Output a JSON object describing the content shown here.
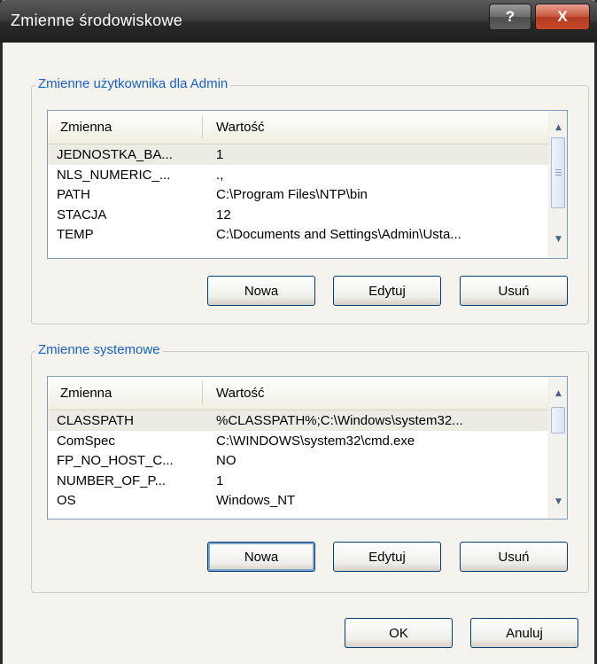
{
  "window": {
    "title": "Zmienne środowiskowe",
    "help_label": "?",
    "close_label": "X"
  },
  "user_group": {
    "title": "Zmienne użytkownika dla Admin",
    "columns": [
      "Zmienna",
      "Wartość"
    ],
    "rows": [
      {
        "name": "JEDNOSTKA_BA...",
        "value": "1"
      },
      {
        "name": "NLS_NUMERIC_...",
        "value": ".,"
      },
      {
        "name": "PATH",
        "value": "C:\\Program Files\\NTP\\bin"
      },
      {
        "name": "STACJA",
        "value": "12"
      },
      {
        "name": "TEMP",
        "value": "C:\\Documents and Settings\\Admin\\Usta..."
      }
    ],
    "buttons": {
      "new": "Nowa",
      "edit": "Edytuj",
      "delete": "Usuń"
    }
  },
  "system_group": {
    "title": "Zmienne systemowe",
    "columns": [
      "Zmienna",
      "Wartość"
    ],
    "rows": [
      {
        "name": "CLASSPATH",
        "value": "%CLASSPATH%;C:\\Windows\\system32..."
      },
      {
        "name": "ComSpec",
        "value": "C:\\WINDOWS\\system32\\cmd.exe"
      },
      {
        "name": "FP_NO_HOST_C...",
        "value": "NO"
      },
      {
        "name": "NUMBER_OF_P...",
        "value": "1"
      },
      {
        "name": "OS",
        "value": "Windows_NT"
      }
    ],
    "buttons": {
      "new": "Nowa",
      "edit": "Edytuj",
      "delete": "Usuń"
    }
  },
  "footer": {
    "ok": "OK",
    "cancel": "Anuluj"
  },
  "icons": {
    "scroll_up": "scroll-up-arrow-icon",
    "scroll_down": "scroll-down-arrow-icon",
    "grip": "scrollbar-grip-icon"
  }
}
